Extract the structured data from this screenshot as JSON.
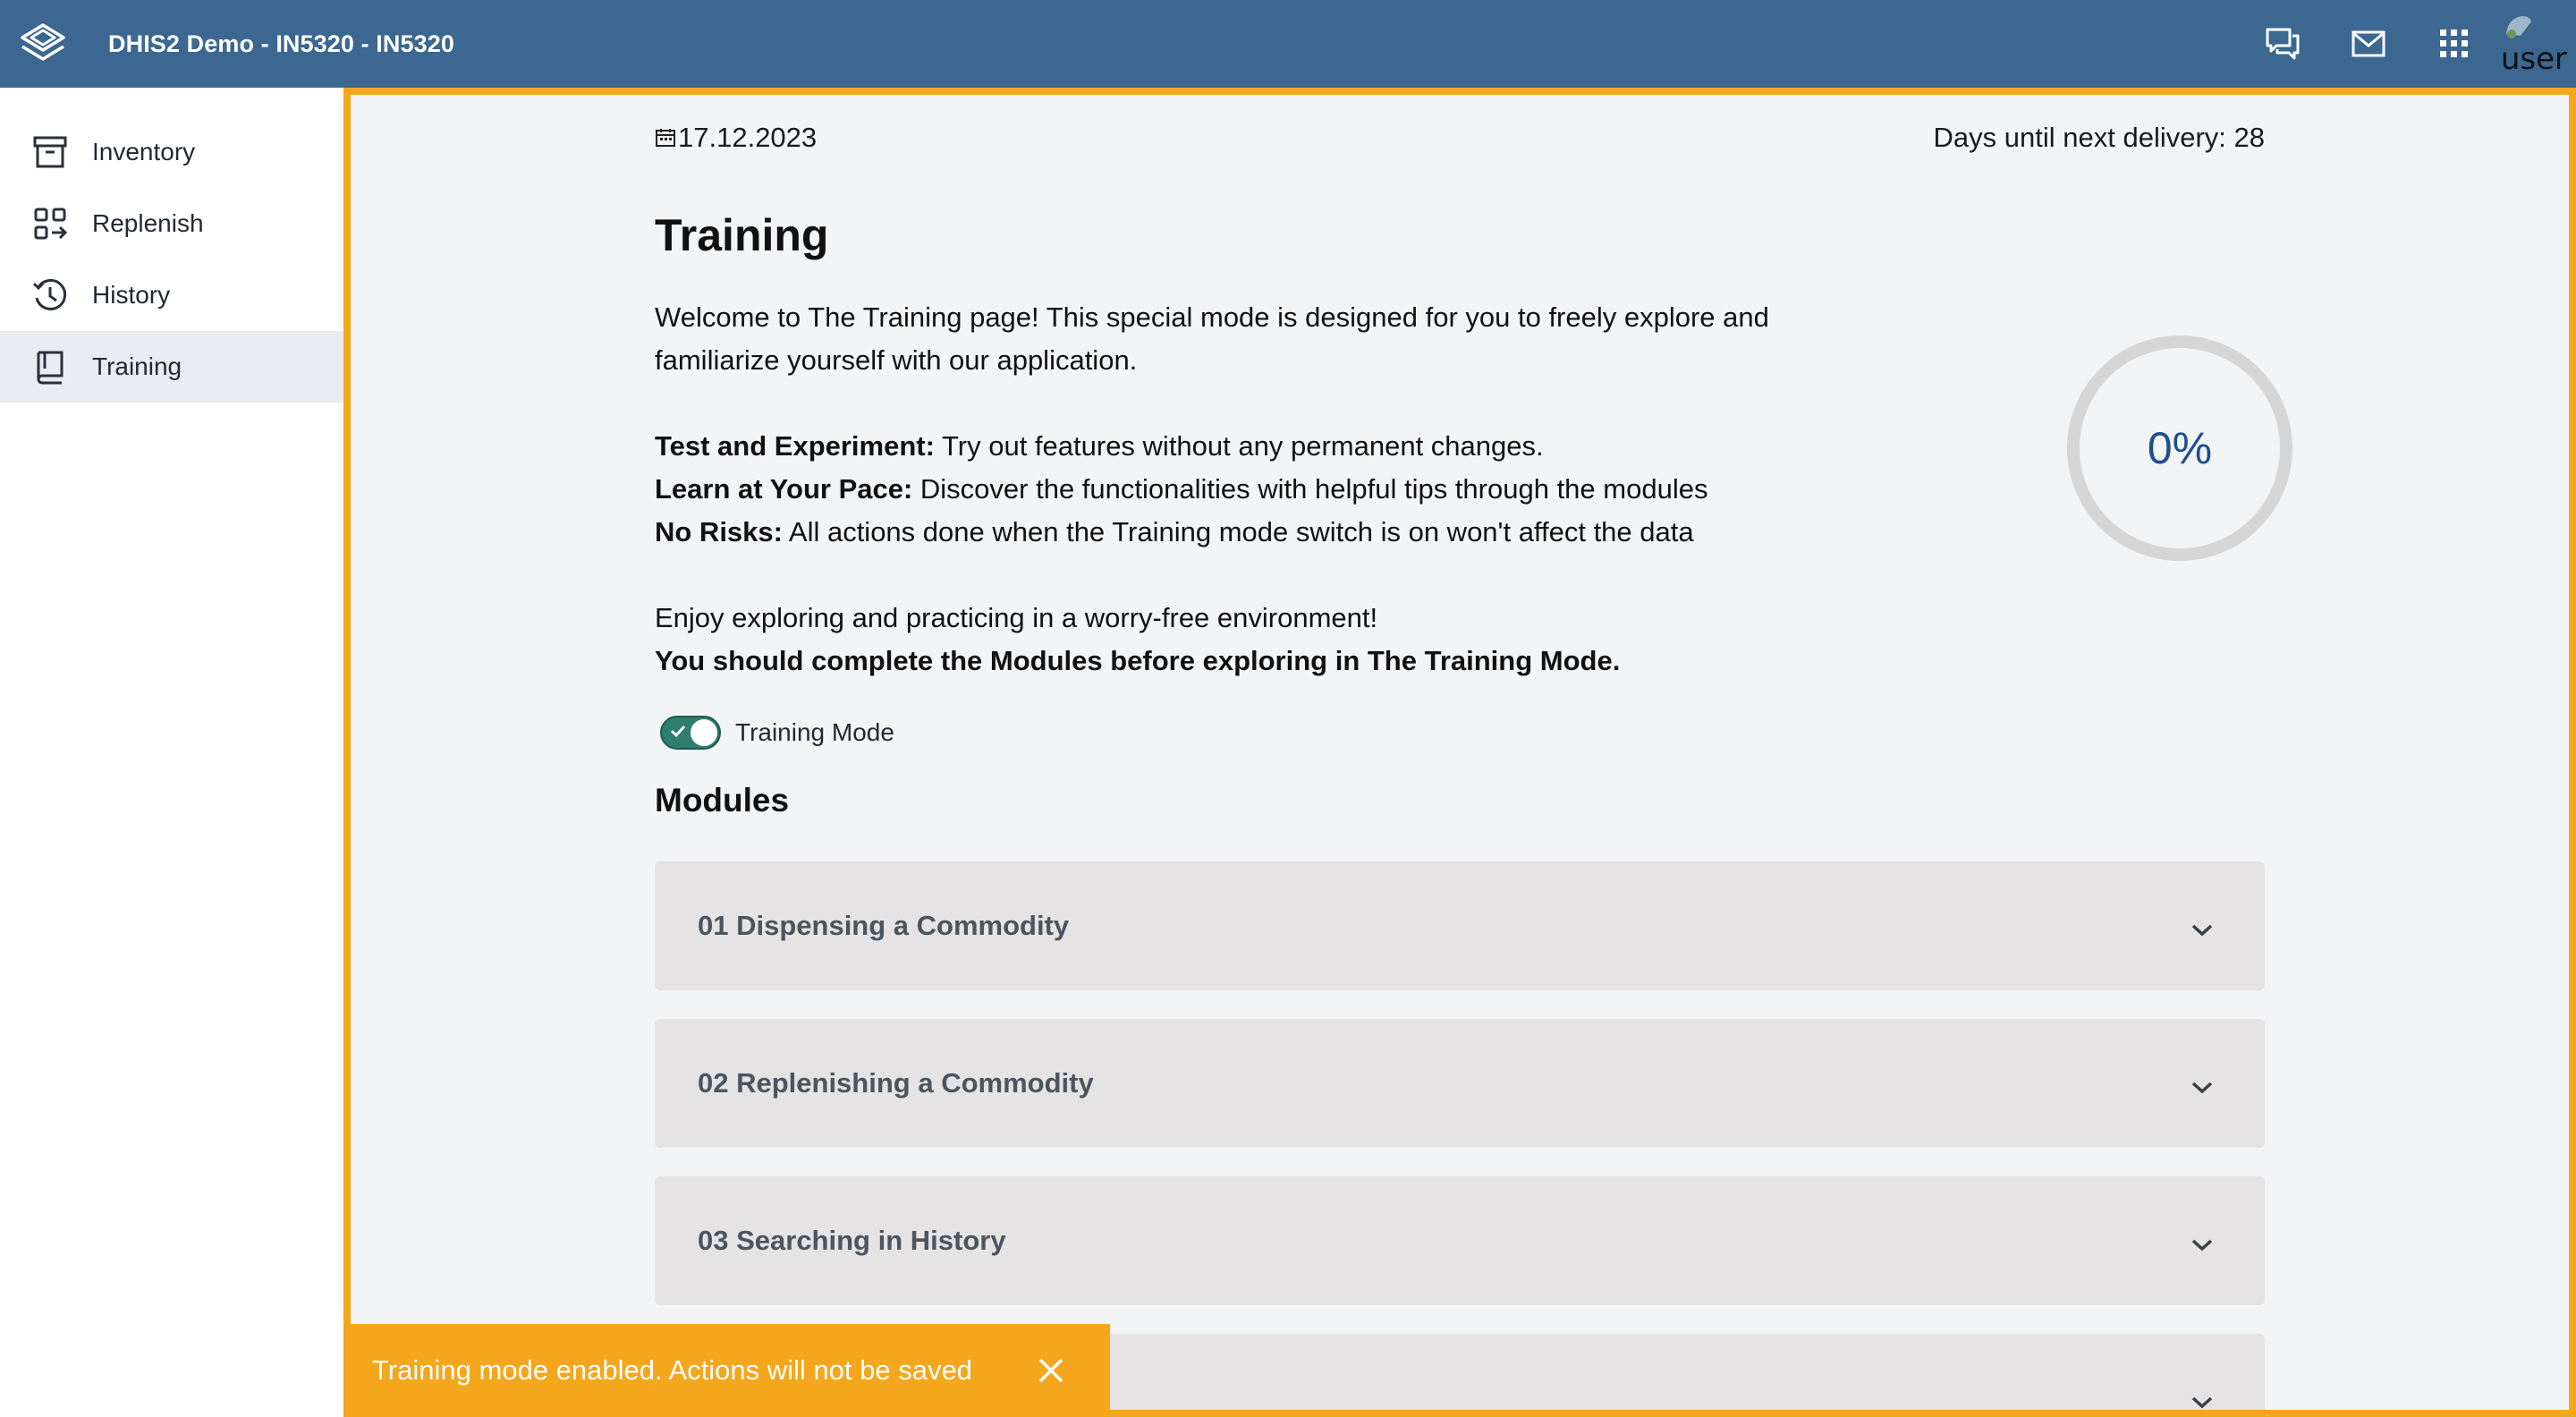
{
  "header": {
    "app_title": "DHIS2 Demo - IN5320 - IN5320",
    "brand_color": "#3b6790",
    "icons": [
      "dhis2-logo-icon",
      "interpretations-icon",
      "messages-icon",
      "apps-icon"
    ],
    "user_alt": "user"
  },
  "sidebar": {
    "items": [
      {
        "label": "Inventory",
        "icon": "archive-box-icon",
        "active": false
      },
      {
        "label": "Replenish",
        "icon": "replenish-icon",
        "active": false
      },
      {
        "label": "History",
        "icon": "history-clock-icon",
        "active": false
      },
      {
        "label": "Training",
        "icon": "book-icon",
        "active": true
      }
    ]
  },
  "main": {
    "frame_color": "#f4a71c",
    "date": "17.12.2023",
    "days_until_delivery": "Days until next delivery: 28",
    "title": "Training",
    "intro_line1": "Welcome to The Training page! This special mode is designed for you to freely explore and",
    "intro_line2": "familiarize yourself with our application.",
    "features": [
      {
        "bold": "Test and Experiment:",
        "text": " Try out features without any permanent changes."
      },
      {
        "bold": "Learn at Your Pace:",
        "text": " Discover the functionalities with helpful tips through the modules"
      },
      {
        "bold": "No Risks:",
        "text": " All actions done when the Training mode switch is on won't affect the data"
      }
    ],
    "enjoy": "Enjoy exploring and practicing in a worry-free environment!",
    "must_complete": "You should complete the Modules before exploring in The Training Mode.",
    "progress": {
      "value": 0,
      "label": "0%"
    },
    "toggle": {
      "label": "Training Mode",
      "on": true
    },
    "modules_title": "Modules",
    "modules": [
      {
        "title": "01 Dispensing a Commodity"
      },
      {
        "title": "02 Replenishing a Commodity"
      },
      {
        "title": "03 Searching in History"
      },
      {
        "title": ""
      }
    ]
  },
  "snackbar": {
    "message": "Training mode enabled. Actions will not be saved",
    "color": "#f4a71c"
  }
}
